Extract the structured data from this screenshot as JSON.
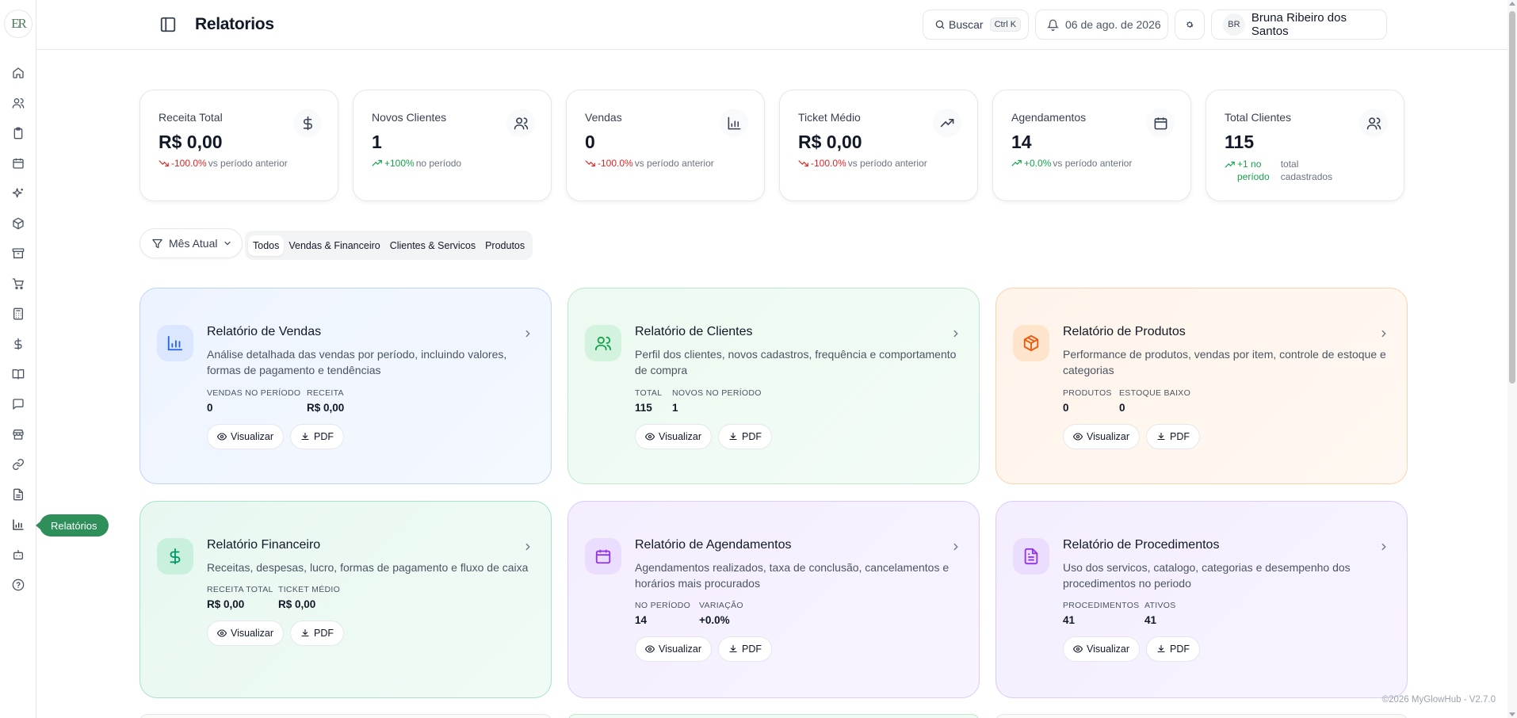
{
  "app": {
    "logo": "ER",
    "footer": "©2026 MyGlowHub - V2.7.0"
  },
  "sidebar": {
    "tooltip": "Relatórios",
    "items": [
      "home-icon",
      "users-icon",
      "clipboard-icon",
      "calendar-icon",
      "sparkles-icon",
      "package-icon",
      "archive-icon",
      "cart-icon",
      "calculator-icon",
      "dollar-icon",
      "book-icon",
      "chat-icon",
      "store-icon",
      "link-icon",
      "file-icon",
      "bar-chart-icon",
      "bot-icon",
      "help-icon"
    ]
  },
  "header": {
    "title": "Relatorios",
    "search_label": "Buscar",
    "search_shortcut": "Ctrl K",
    "date": "06 de ago. de 2026",
    "user_initials": "BR",
    "user_name": "Bruna Ribeiro dos Santos"
  },
  "stats": [
    {
      "label": "Receita Total",
      "value": "R$ 0,00",
      "change": "-100.0%",
      "direction": "down",
      "note": "vs período anterior",
      "icon": "dollar-icon"
    },
    {
      "label": "Novos Clientes",
      "value": "1",
      "change": "+100%",
      "direction": "up",
      "note": "no período",
      "icon": "users-icon"
    },
    {
      "label": "Vendas",
      "value": "0",
      "change": "-100.0%",
      "direction": "down",
      "note": "vs período anterior",
      "icon": "bar-chart-icon"
    },
    {
      "label": "Ticket Médio",
      "value": "R$ 0,00",
      "change": "-100.0%",
      "direction": "down",
      "note": "vs período anterior",
      "icon": "trending-up-icon"
    },
    {
      "label": "Agendamentos",
      "value": "14",
      "change": "+0.0%",
      "direction": "up",
      "note": "vs período anterior",
      "icon": "calendar-icon"
    },
    {
      "label": "Total Clientes",
      "value": "115",
      "change_line1": "+1 no",
      "change_line2": "período",
      "note_line1": "total",
      "note_line2": "cadastrados",
      "direction": "up",
      "icon": "users-icon"
    }
  ],
  "filters": {
    "period": "Mês Atual",
    "tabs": [
      "Todos",
      "Vendas & Financeiro",
      "Clientes & Servicos",
      "Produtos"
    ],
    "active_tab": "Todos"
  },
  "reports": [
    {
      "title": "Relatório de Vendas",
      "description": "Análise detalhada das vendas por período, incluindo valores, formas de pagamento e tendências",
      "stat1_label": "VENDAS NO PERÍODO",
      "stat1_value": "0",
      "stat2_label": "RECEITA",
      "stat2_value": "R$ 0,00",
      "view": "Visualizar",
      "pdf": "PDF",
      "color": "#2563eb"
    },
    {
      "title": "Relatório de Clientes",
      "description": "Perfil dos clientes, novos cadastros, frequência e comportamento de compra",
      "stat1_label": "TOTAL",
      "stat1_value": "115",
      "stat2_label": "NOVOS NO PERÍODO",
      "stat2_value": "1",
      "view": "Visualizar",
      "pdf": "PDF",
      "color": "#16a34a"
    },
    {
      "title": "Relatório de Produtos",
      "description": "Performance de produtos, vendas por item, controle de estoque e categorias",
      "stat1_label": "PRODUTOS",
      "stat1_value": "0",
      "stat2_label": "ESTOQUE BAIXO",
      "stat2_value": "0",
      "view": "Visualizar",
      "pdf": "PDF",
      "color": "#ea580c"
    },
    {
      "title": "Relatório Financeiro",
      "description": "Receitas, despesas, lucro, formas de pagamento e fluxo de caixa",
      "stat1_label": "RECEITA TOTAL",
      "stat1_value": "R$ 0,00",
      "stat2_label": "TICKET MÉDIO",
      "stat2_value": "R$ 0,00",
      "view": "Visualizar",
      "pdf": "PDF",
      "color": "#059669"
    },
    {
      "title": "Relatório de Agendamentos",
      "description": "Agendamentos realizados, taxa de conclusão, cancelamentos e horários mais procurados",
      "stat1_label": "NO PERÍODO",
      "stat1_value": "14",
      "stat2_label": "VARIAÇÃO",
      "stat2_value": "+0.0%",
      "view": "Visualizar",
      "pdf": "PDF",
      "color": "#9333ea"
    },
    {
      "title": "Relatório de Procedimentos",
      "description": "Uso dos servicos, catalogo, categorias e desempenho dos procedimentos no periodo",
      "stat1_label": "PROCEDIMENTOS",
      "stat1_value": "41",
      "stat2_label": "ATIVOS",
      "stat2_value": "41",
      "view": "Visualizar",
      "pdf": "PDF",
      "color": "#9333ea"
    }
  ]
}
